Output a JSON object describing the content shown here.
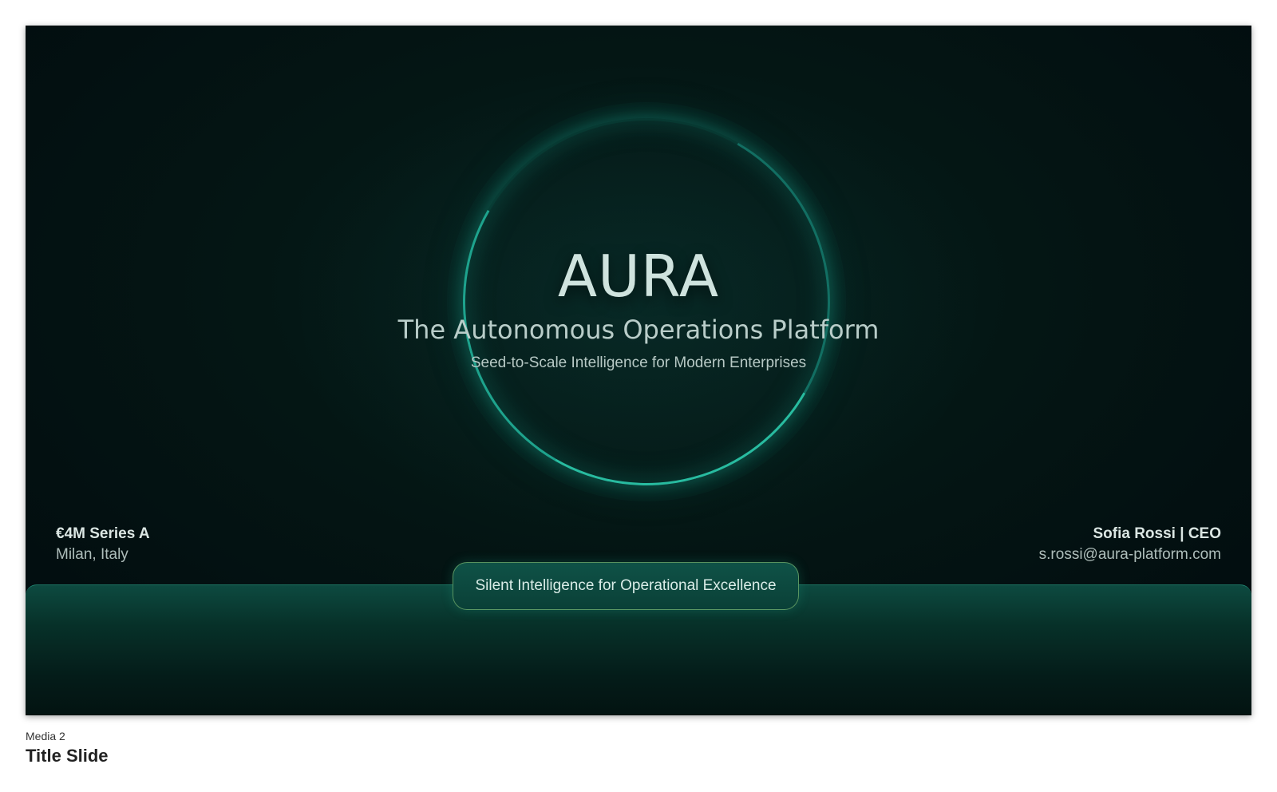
{
  "slide": {
    "title": "AURA",
    "subtitle": "The Autonomous Operations Platform",
    "tagline": "Seed-to-Scale Intelligence for Modern Enterprises",
    "left_info": {
      "funding": "€4M Series A",
      "location": "Milan, Italy"
    },
    "right_info": {
      "presenter": "Sofia Rossi | CEO",
      "email": "s.rossi@aura-platform.com"
    },
    "pill_text": "Silent Intelligence for Operational Excellence",
    "colors": {
      "background": "#041614",
      "accent": "#2ec9a8",
      "band": "#0d4a40"
    }
  },
  "caption": {
    "media_label": "Media 2",
    "title": "Title Slide"
  }
}
